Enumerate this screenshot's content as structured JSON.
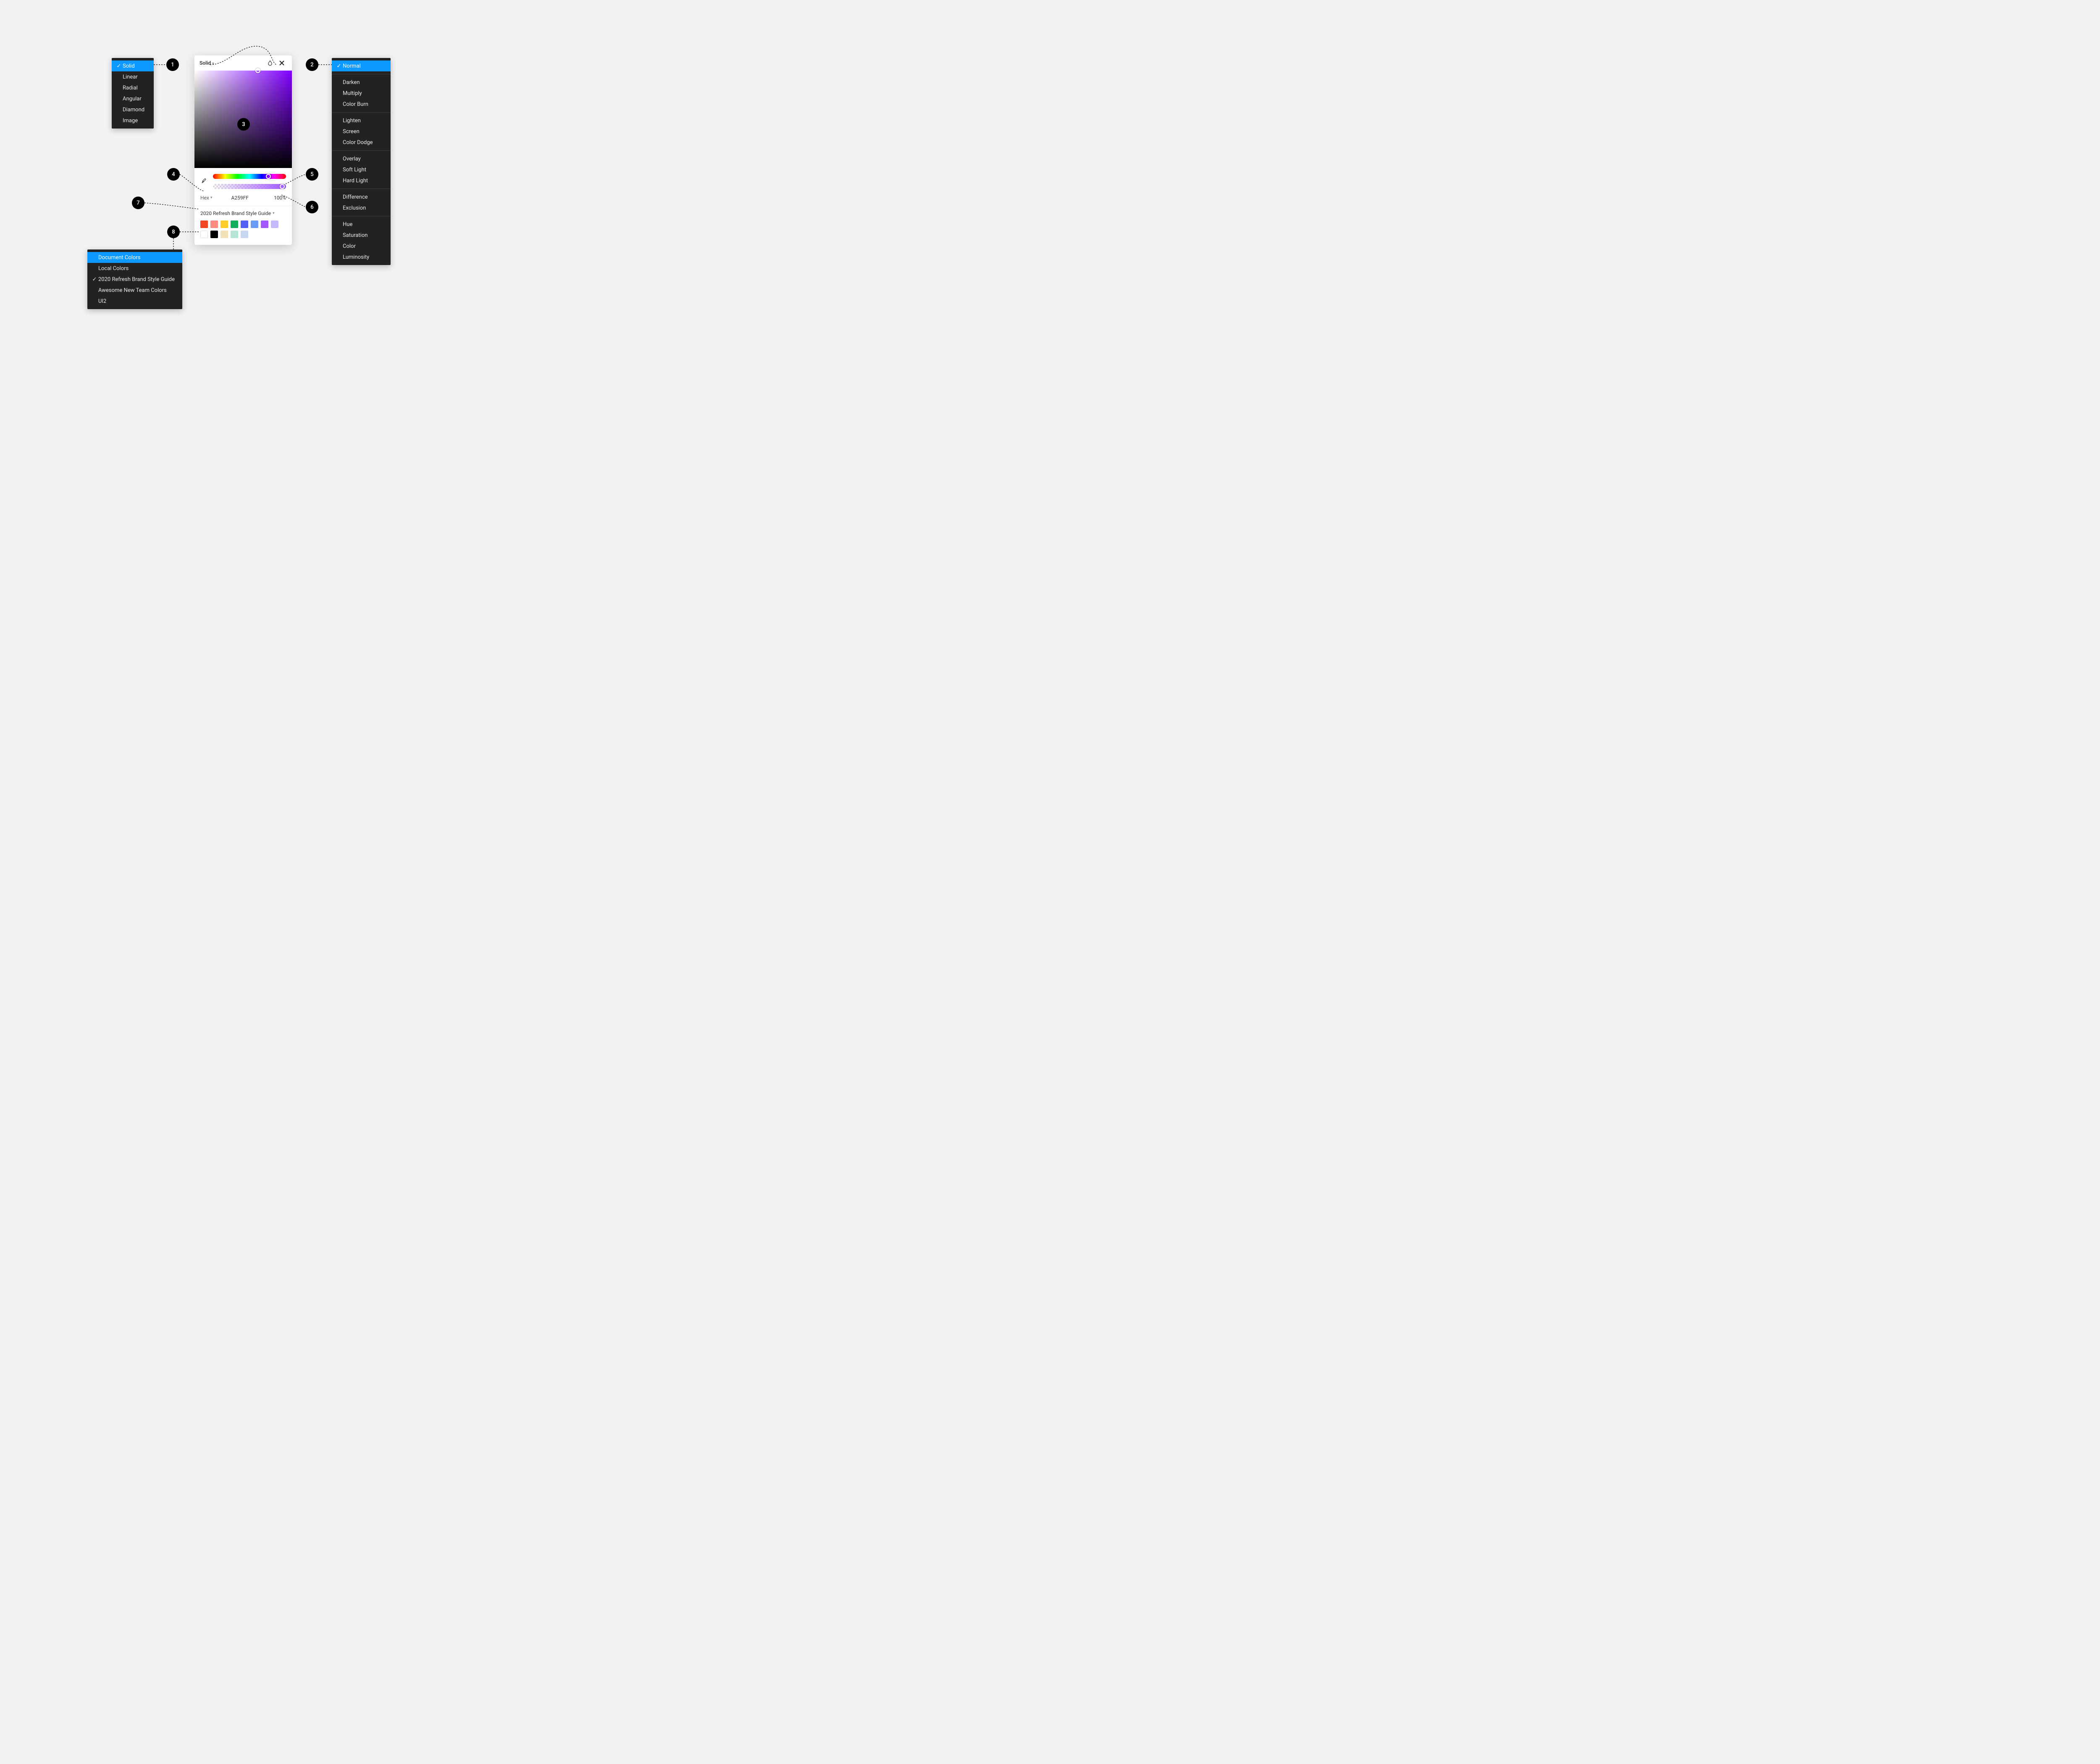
{
  "fill_type_menu": {
    "items": [
      "Solid",
      "Linear",
      "Radial",
      "Angular",
      "Diamond",
      "Image"
    ],
    "selected_index": 0
  },
  "blend_mode_menu": {
    "groups": [
      [
        "Normal"
      ],
      [
        "Darken",
        "Multiply",
        "Color Burn"
      ],
      [
        "Lighten",
        "Screen",
        "Color Dodge"
      ],
      [
        "Overlay",
        "Soft Light",
        "Hard Light"
      ],
      [
        "Difference",
        "Exclusion"
      ],
      [
        "Hue",
        "Saturation",
        "Color",
        "Luminosity"
      ]
    ],
    "selected": "Normal"
  },
  "picker": {
    "title": "Solid",
    "color_model": "Hex",
    "hex": "A259FF",
    "opacity": "100%",
    "library_label": "2020 Refresh Brand Style Guide",
    "swatches": [
      "#f24822",
      "#ff8a80",
      "#ffcd29",
      "#14ae5c",
      "#5560f7",
      "#699bf7",
      "#a259ff",
      "#c7b9ff",
      "#ffffff",
      "#000000",
      "#f0e2b6",
      "#b6e5d8",
      "#c7d7f0"
    ]
  },
  "library_menu": {
    "items": [
      "Document Colors",
      "Local Colors",
      "2020 Refresh Brand Style Guide",
      "Awesome New Team Colors",
      "UI2"
    ],
    "hovered_index": 0,
    "checked_index": 2
  },
  "annotations": {
    "1": "1",
    "2": "2",
    "3": "3",
    "4": "4",
    "5": "5",
    "6": "6",
    "7": "7",
    "8": "8"
  }
}
